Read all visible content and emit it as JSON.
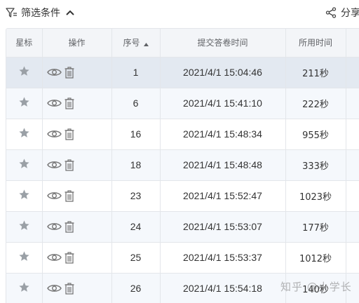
{
  "toolbar": {
    "filter_label": "筛选条件",
    "share_label": "分享"
  },
  "table": {
    "headers": {
      "star": "星标",
      "ops": "操作",
      "seq": "序号",
      "submit_time": "提交答卷时间",
      "duration": "所用时间"
    },
    "sort_column": "seq",
    "sort_direction": "ascending",
    "rows": [
      {
        "seq": "1",
        "time": "2021/4/1 15:04:46",
        "duration": "211秒",
        "selected": true
      },
      {
        "seq": "6",
        "time": "2021/4/1 15:41:10",
        "duration": "222秒"
      },
      {
        "seq": "16",
        "time": "2021/4/1 15:48:34",
        "duration": "955秒"
      },
      {
        "seq": "18",
        "time": "2021/4/1 15:48:48",
        "duration": "333秒"
      },
      {
        "seq": "23",
        "time": "2021/4/1 15:52:47",
        "duration": "1023秒"
      },
      {
        "seq": "24",
        "time": "2021/4/1 15:53:07",
        "duration": "177秒"
      },
      {
        "seq": "25",
        "time": "2021/4/1 15:53:37",
        "duration": "1012秒"
      },
      {
        "seq": "26",
        "time": "2021/4/1 15:54:18",
        "duration": "140秒"
      }
    ]
  },
  "icons": {
    "filter": "filter-icon",
    "chevron": "chevron-up-icon",
    "share": "share-icon",
    "star": "star-icon",
    "view": "eye-icon",
    "delete": "trash-icon",
    "sort": "sort-asc-icon"
  },
  "colors": {
    "header_bg": "#f3f5f8",
    "row_even_bg": "#f5f8fc",
    "row_selected_bg": "#e3e9f1",
    "border": "#e3e6ea",
    "icon_gray": "#9aa0a6",
    "text": "#333333"
  },
  "watermark": "知乎 @小学长"
}
